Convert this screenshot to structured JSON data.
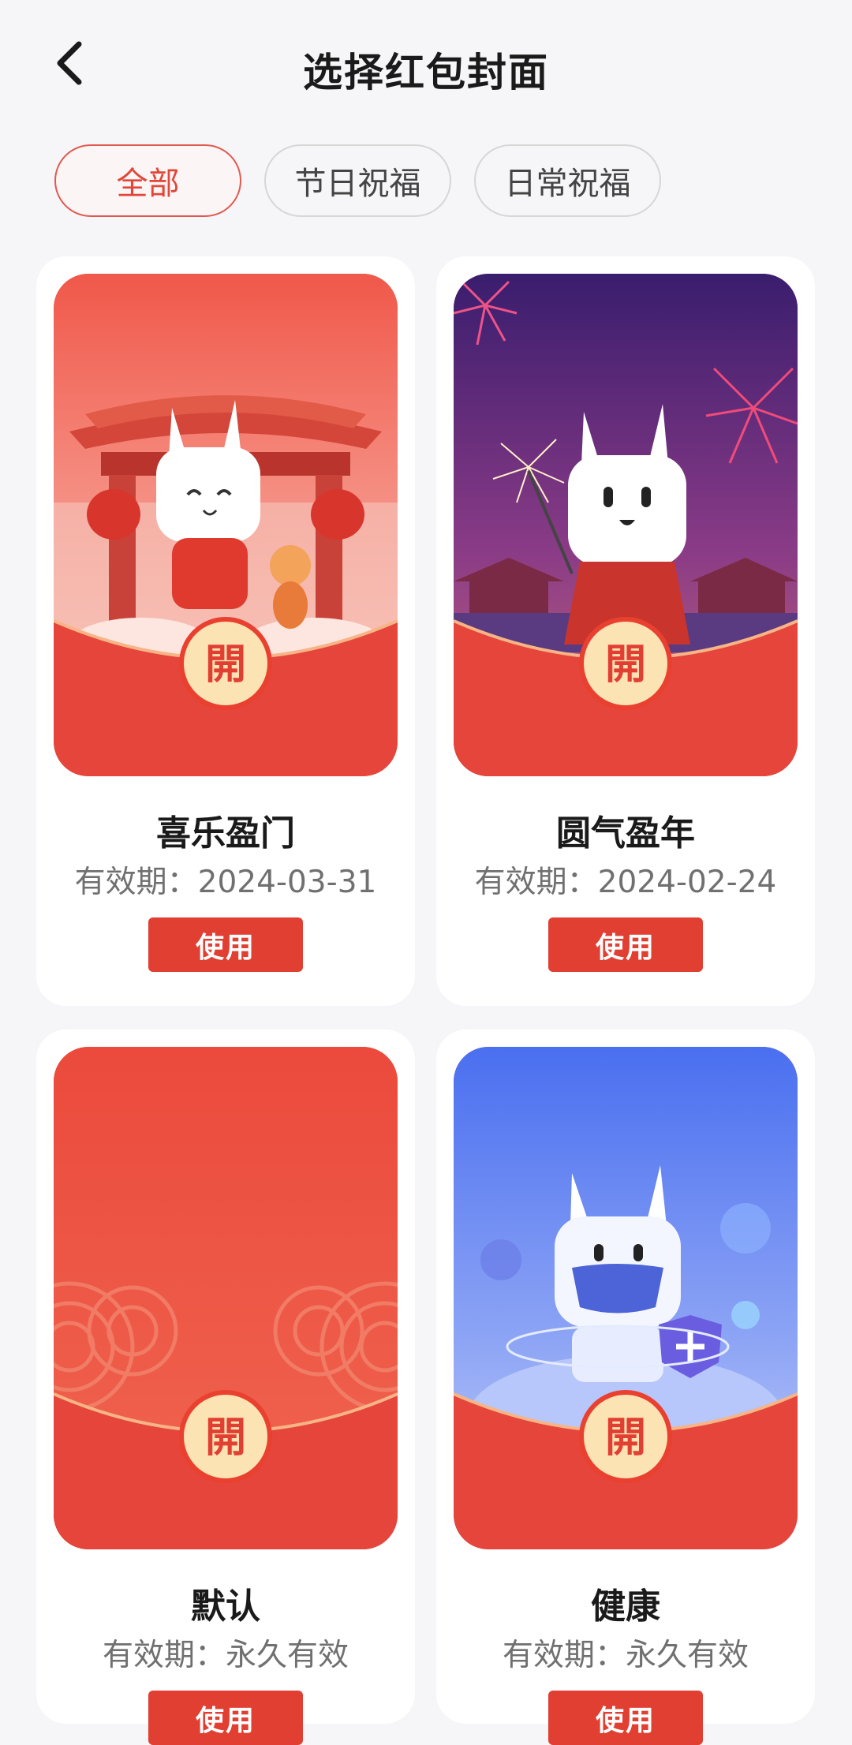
{
  "header": {
    "title": "选择红包封面",
    "back_icon": "chevron-left-icon"
  },
  "tabs": [
    {
      "label": "全部",
      "active": true
    },
    {
      "label": "节日祝福",
      "active": false
    },
    {
      "label": "日常祝福",
      "active": false
    }
  ],
  "cards": [
    {
      "name": "喜乐盈门",
      "validity": "有效期：2024-03-31",
      "use_label": "使用",
      "open_char": "開",
      "theme": "lunar-gate"
    },
    {
      "name": "圆气盈年",
      "validity": "有效期：2024-02-24",
      "use_label": "使用",
      "open_char": "開",
      "theme": "fireworks-night"
    },
    {
      "name": "默认",
      "validity": "有效期：永久有效",
      "use_label": "使用",
      "open_char": "開",
      "theme": "default-red"
    },
    {
      "name": "健康",
      "validity": "有效期：永久有效",
      "use_label": "使用",
      "open_char": "開",
      "theme": "health-blue"
    }
  ],
  "colors": {
    "accent": "#e23f33",
    "envelope_red": "#e8473b",
    "seal_gold": "#fce3b4",
    "active_tab_border": "#e0594f"
  }
}
